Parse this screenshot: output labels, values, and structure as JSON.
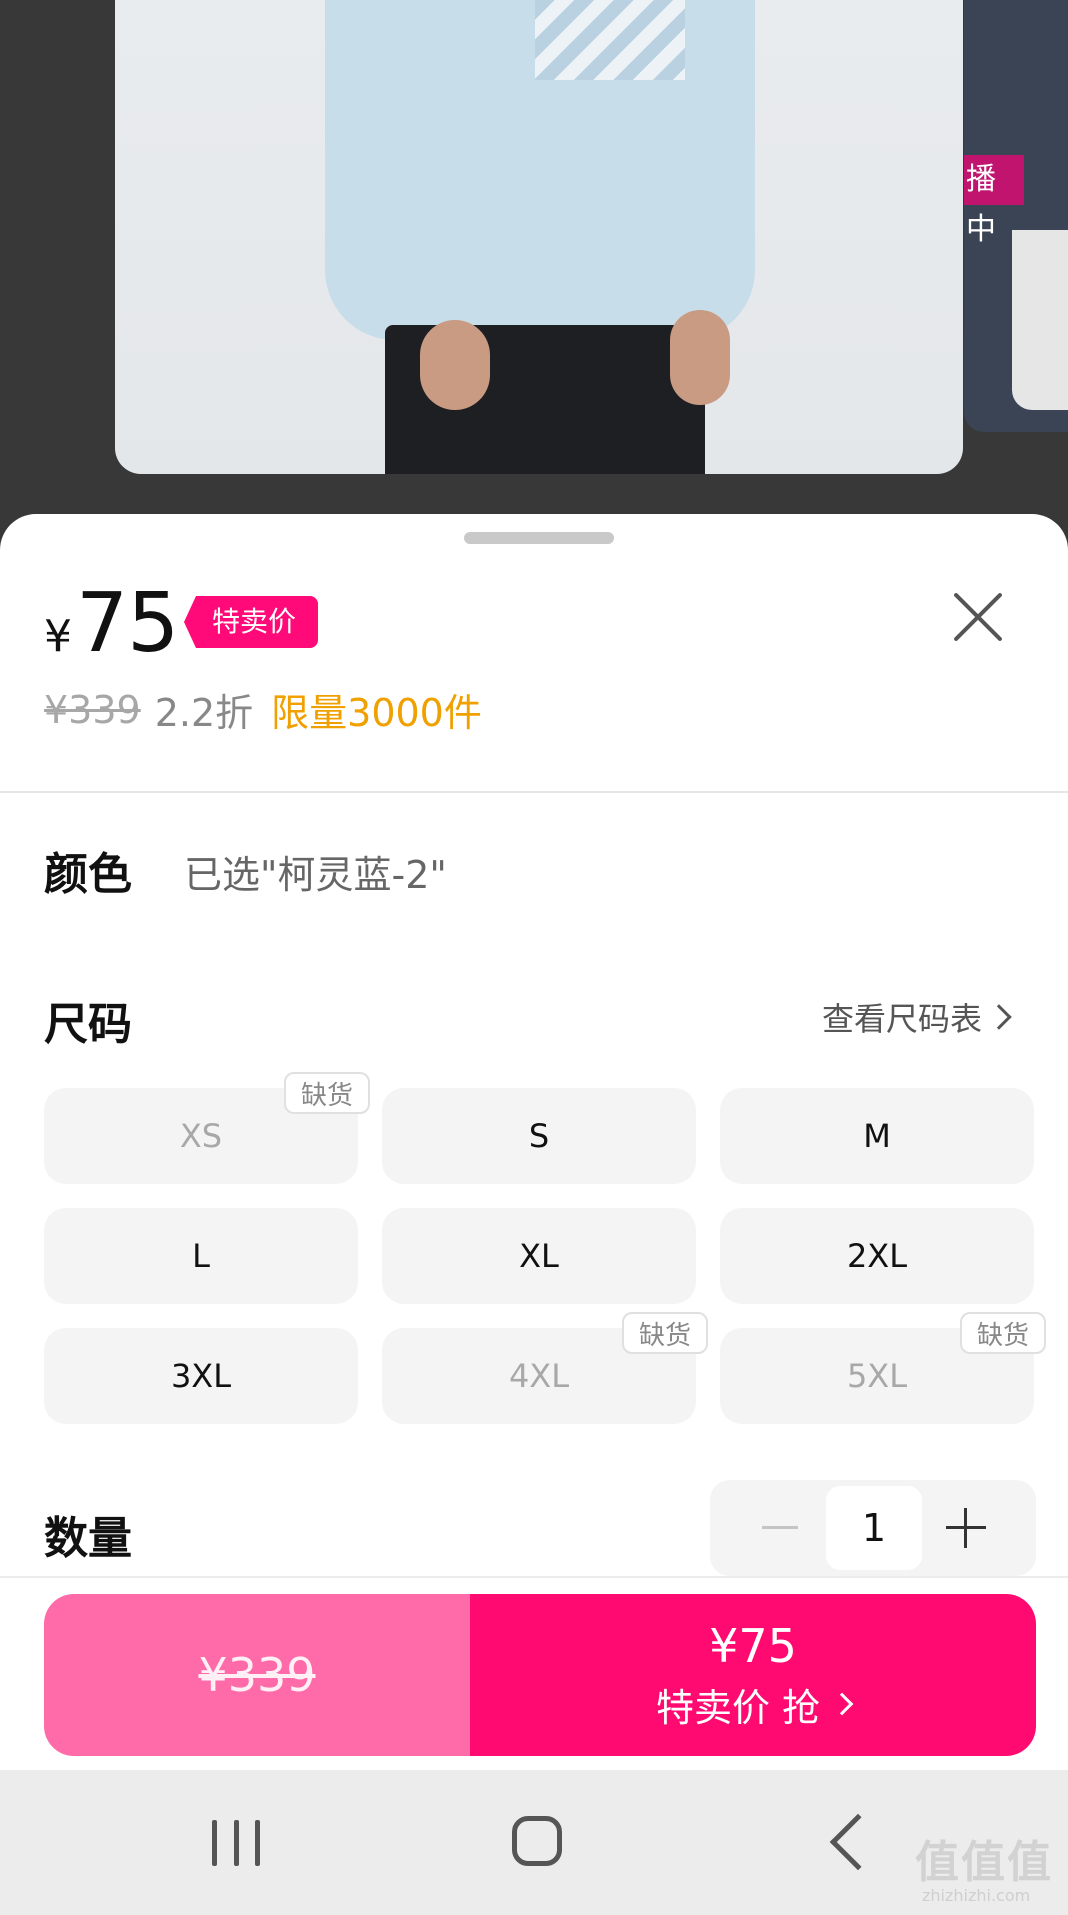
{
  "hero": {
    "side_badge": "播中"
  },
  "product": {
    "currency": "¥",
    "price": "75",
    "tag": "特卖价",
    "original_price": "¥339",
    "discount": "2.2折",
    "limit": "限量3000件"
  },
  "color": {
    "label": "颜色",
    "selected": "已选\"柯灵蓝-2\""
  },
  "size": {
    "label": "尺码",
    "chart_link": "查看尺码表",
    "out_of_stock_label": "缺货",
    "options": [
      {
        "label": "XS",
        "available": false
      },
      {
        "label": "S",
        "available": true
      },
      {
        "label": "M",
        "available": true
      },
      {
        "label": "L",
        "available": true
      },
      {
        "label": "XL",
        "available": true
      },
      {
        "label": "2XL",
        "available": true
      },
      {
        "label": "3XL",
        "available": true
      },
      {
        "label": "4XL",
        "available": false
      },
      {
        "label": "5XL",
        "available": false
      }
    ]
  },
  "quantity": {
    "label": "数量",
    "value": "1"
  },
  "buy_bar": {
    "original_price": "¥339",
    "sale_price": "¥75",
    "action_label": "特卖价 抢"
  },
  "watermark": {
    "text": "值值值",
    "url": "zhizhizhi.com"
  },
  "colors": {
    "brand_pink": "#ff0a70",
    "light_pink": "#ff6aa8",
    "limit_orange": "#f0a000"
  }
}
